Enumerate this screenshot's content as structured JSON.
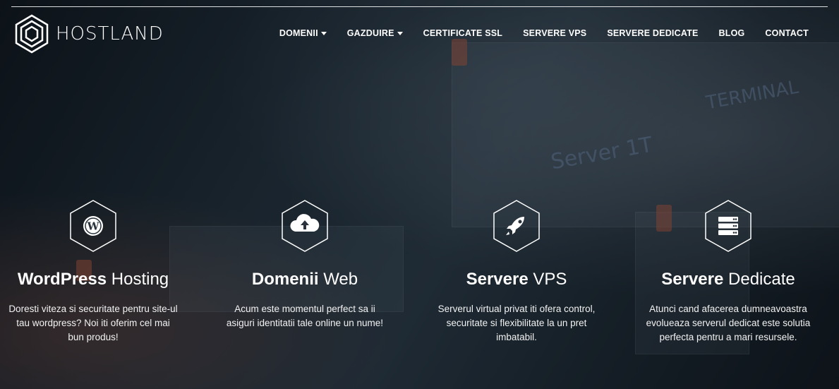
{
  "brand": {
    "name": "HOSTLAND"
  },
  "nav": {
    "items": [
      {
        "label": "DOMENII",
        "dropdown": true
      },
      {
        "label": "GAZDUIRE",
        "dropdown": true
      },
      {
        "label": "CERTIFICATE SSL",
        "dropdown": false
      },
      {
        "label": "SERVERE VPS",
        "dropdown": false
      },
      {
        "label": "SERVERE DEDICATE",
        "dropdown": false
      },
      {
        "label": "BLOG",
        "dropdown": false
      },
      {
        "label": "CONTACT",
        "dropdown": false
      }
    ]
  },
  "background": {
    "label_server": "Server 1T",
    "label_terminal": "TERMINAL"
  },
  "features": [
    {
      "icon": "wordpress-icon",
      "title_bold": "WordPress",
      "title_rest": " Hosting",
      "description": "Doresti viteza si securitate pentru site-ul tau wordpress? Noi iti oferim cel mai bun produs!"
    },
    {
      "icon": "cloud-upload-icon",
      "title_bold": "Domenii",
      "title_rest": " Web",
      "description": "Acum este momentul perfect sa ii asiguri identitatii tale online un nume!"
    },
    {
      "icon": "rocket-icon",
      "title_bold": "Servere",
      "title_rest": " VPS",
      "description": "Serverul virtual privat iti ofera control, securitate si flexibilitate la un pret imbatabil."
    },
    {
      "icon": "server-icon",
      "title_bold": "Servere",
      "title_rest": " Dedicate",
      "description": "Atunci cand afacerea dumneavoastra evolueaza serverul dedicat este solutia perfecta pentru a mari resursele."
    }
  ]
}
